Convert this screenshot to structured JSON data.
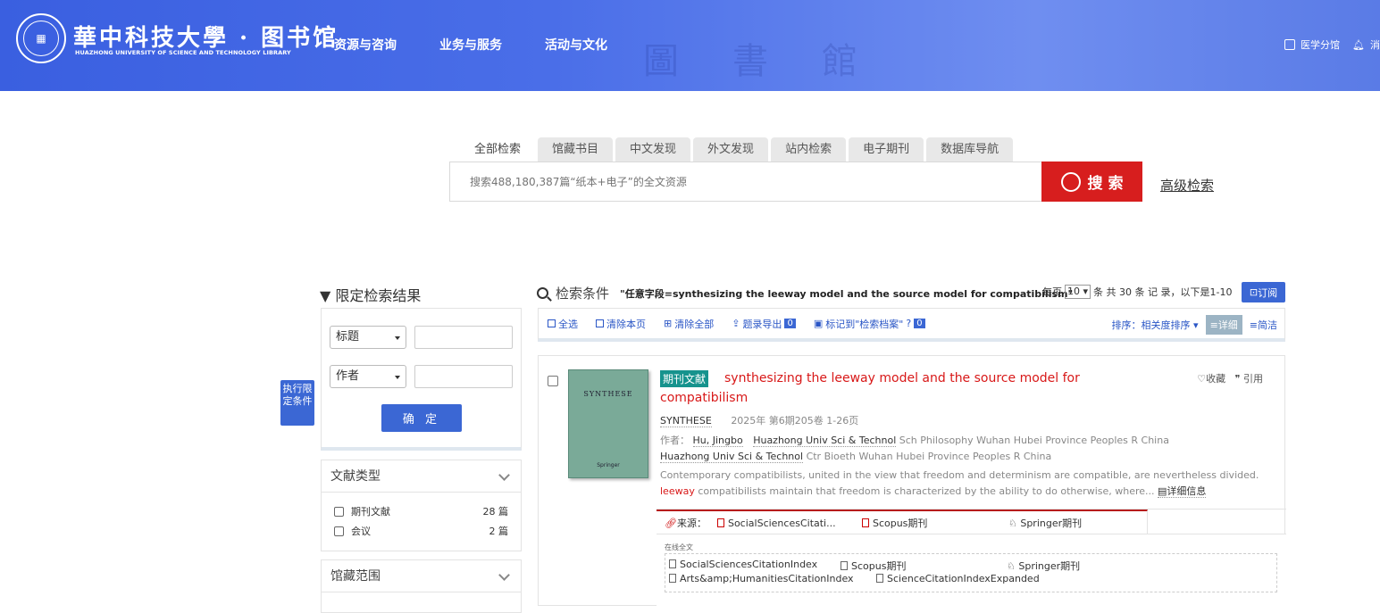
{
  "header": {
    "logo_title": "華中科技大學 · 图书馆",
    "logo_subtitle": "HUAZHONG UNIVERSITY OF SCIENCE AND TECHNOLOGY LIBRARY",
    "bg_text": "圖書館",
    "nav": [
      "资源与咨询",
      "业务与服务",
      "活动与文化"
    ],
    "right_links": [
      "医学分馆",
      "消"
    ]
  },
  "search": {
    "tabs": [
      "全部检索",
      "馆藏书目",
      "中文发现",
      "外文发现",
      "站内检索",
      "电子期刊",
      "数据库导航"
    ],
    "placeholder": "搜索488,180,387篇“纸本+电子”的全文资源",
    "button": "搜 索",
    "advanced": "高级检索"
  },
  "limit": {
    "title": "限定检索结果",
    "field1": "标题",
    "field2": "作者",
    "confirm": "确 定",
    "exec_tag": "执行限定条件"
  },
  "facets": [
    {
      "title": "文献类型",
      "items": [
        {
          "label": "期刊文献",
          "count": "28 篇"
        },
        {
          "label": "会议",
          "count": "2 篇"
        }
      ]
    },
    {
      "title": "馆藏范围",
      "items": []
    }
  ],
  "results_header": {
    "label": "检索条件",
    "query": "\"任意字段=synthesizing the leeway model and the source model for compatibilism\"",
    "per_page_label": "每页",
    "per_page": "10",
    "total_text": "条 共 30 条 记 录，以下是1-10",
    "subscribe": "订阅"
  },
  "toolbar": {
    "select_all": "全选",
    "clear_page": "清除本页",
    "clear_all": "清除全部",
    "export": "题录导出",
    "export_count": "0",
    "mark": "标记到\"检索档案\"",
    "mark_count": "0",
    "sort_label": "排序：相关度排序",
    "detail": "详细",
    "brief": "简洁"
  },
  "result": {
    "cover_title": "SYNTHESE",
    "cover_publisher": "Springer",
    "type_tag": "期刊文献",
    "title": "synthesizing the leeway model and the source model for compatibilism",
    "favorite": "收藏",
    "cite": "引用",
    "source": "SYNTHESE",
    "year_info": "2025年 第6期205卷 1-26页",
    "author_label": "作者：",
    "author": "Hu, Jingbo",
    "org1": "Huazhong Univ Sci & Technol",
    "org1_detail": "Sch Philosophy Wuhan Hubei Province Peoples R China",
    "org2": "Huazhong Univ Sci & Technol",
    "org2_detail": "Ctr Bioeth Wuhan Hubei Province Peoples R China",
    "abstract_a": "Contemporary compatibilists, united in the view that freedom and determinism are compatible, are nevertheless divided. ",
    "abstract_hl": "leeway",
    "abstract_b": " compatibilists maintain that freedom is characterized by the ability to do otherwise, where...",
    "more": "详细信息",
    "source_label": "来源：",
    "sources": [
      "SocialSciencesCitati...",
      "Scopus期刊",
      "Springer期刊"
    ],
    "online_title": "在线全文",
    "online_links": [
      "SocialSciencesCitationIndex",
      "Scopus期刊",
      "Springer期刊",
      "Arts&amp;HumanitiesCitationIndex",
      "ScienceCitationIndexExpanded"
    ]
  }
}
